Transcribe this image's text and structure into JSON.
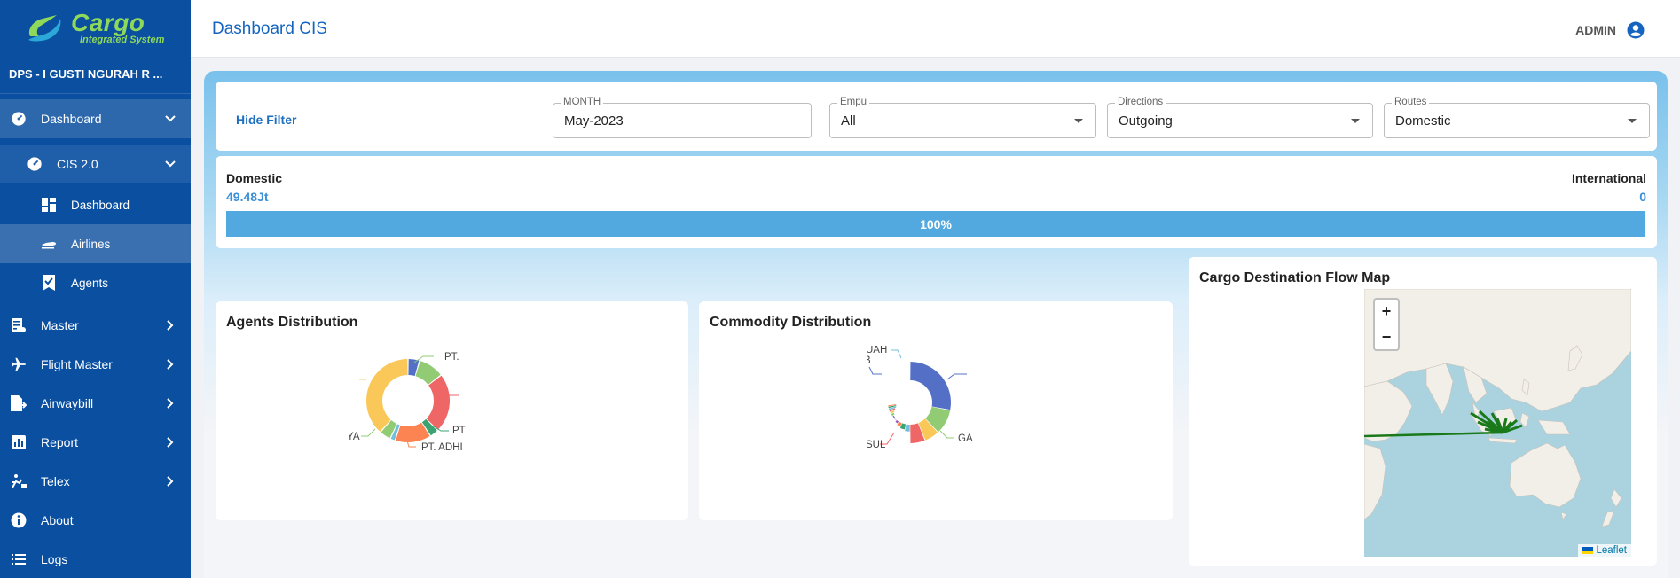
{
  "app": {
    "logo_title": "Cargo",
    "logo_subtitle": "Integrated System"
  },
  "sidebar": {
    "station": "DPS - I GUSTI NGURAH R ...",
    "items": [
      {
        "label": "Dashboard",
        "icon": "speedometer-icon",
        "expanded": true
      },
      {
        "label": "CIS 2.0",
        "icon": "speedometer-icon",
        "expanded": true
      },
      {
        "label": "Dashboard",
        "icon": "dashboard-grid-icon"
      },
      {
        "label": "Airlines",
        "icon": "airline-icon",
        "active": true
      },
      {
        "label": "Agents",
        "icon": "agent-badge-icon"
      },
      {
        "label": "Master",
        "icon": "document-list-icon"
      },
      {
        "label": "Flight Master",
        "icon": "airplane-icon"
      },
      {
        "label": "Airwaybill",
        "icon": "file-export-icon"
      },
      {
        "label": "Report",
        "icon": "bar-chart-icon"
      },
      {
        "label": "Telex",
        "icon": "telex-icon"
      },
      {
        "label": "About",
        "icon": "info-icon"
      },
      {
        "label": "Logs",
        "icon": "list-icon"
      }
    ]
  },
  "header": {
    "title": "Dashboard CIS",
    "user": "ADMIN"
  },
  "filters": {
    "hide_label": "Hide Filter",
    "month": {
      "label": "MONTH",
      "value": "May-2023"
    },
    "empu": {
      "label": "Empu",
      "value": "All"
    },
    "directions": {
      "label": "Directions",
      "value": "Outgoing"
    },
    "routes": {
      "label": "Routes",
      "value": "Domestic"
    }
  },
  "routes_summary": {
    "domestic_label": "Domestic",
    "domestic_value": "49.48Jt",
    "international_label": "International",
    "international_value": "0",
    "domestic_share": 1.0,
    "progress_text": "100%"
  },
  "agents": {
    "title": "Agents Distribution",
    "labels": [
      "PT.",
      "PT",
      "PT. ADHI",
      "YA"
    ],
    "slice_colors": [
      "#5470c6",
      "#91cc75",
      "#ee6666",
      "#3ba272",
      "#fc8452",
      "#73c0de",
      "#91cc75",
      "#fac858"
    ]
  },
  "commodity": {
    "title": "Commodity Distribution",
    "labels": [
      "UAH",
      "B",
      "GA",
      "SUL"
    ],
    "slice_colors": [
      "#5470c6",
      "#91cc75",
      "#fac858",
      "#ee6666",
      "#73c0de",
      "#3ba272",
      "#fc8452",
      "#9a60b4",
      "#ea7ccc"
    ]
  },
  "map": {
    "title": "Cargo Destination Flow Map",
    "zoom_in": "+",
    "zoom_out": "−",
    "attribution": "Leaflet",
    "flow_color": "#1a7a1a"
  }
}
